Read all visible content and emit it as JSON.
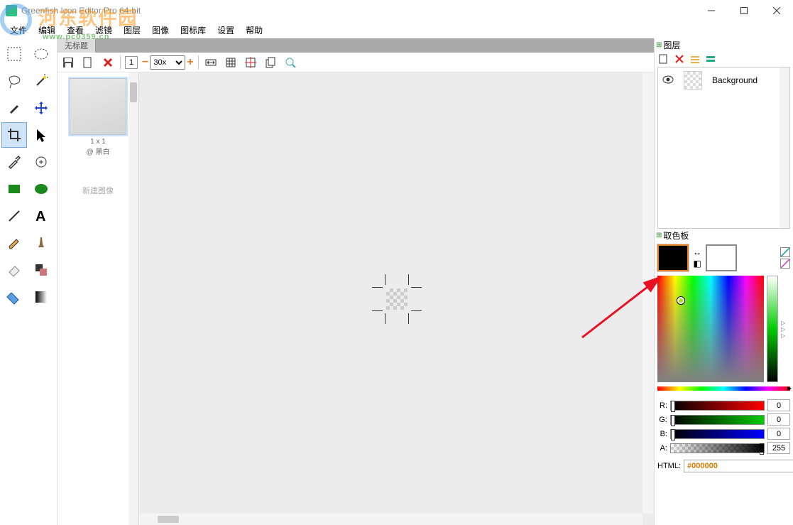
{
  "window": {
    "title": "Greenfish Icon Editor Pro 64-bit"
  },
  "menu": {
    "file": "文件",
    "edit": "编辑",
    "view": "查看",
    "filter": "滤镜",
    "layer": "图层",
    "image": "图像",
    "iconlib": "图标库",
    "settings": "设置",
    "help": "帮助"
  },
  "tabs": {
    "untitled": "无标题"
  },
  "toolbar": {
    "zoom_value": "30x",
    "frame_num": "1"
  },
  "pages": {
    "size_label": "1 x 1",
    "mode_label": "@ 黑白",
    "new_image": "新建图像"
  },
  "panels": {
    "layers_title": "图层",
    "colors_title": "取色板"
  },
  "layers": {
    "row0": {
      "name": "Background"
    }
  },
  "color": {
    "r_label": "R:",
    "g_label": "G:",
    "b_label": "B:",
    "a_label": "A:",
    "r_value": "0",
    "g_value": "0",
    "b_value": "0",
    "a_value": "255",
    "html_label": "HTML:",
    "html_value": "#000000"
  },
  "watermark": {
    "text": "河东软件园",
    "url": "www.pc0359.cn"
  }
}
